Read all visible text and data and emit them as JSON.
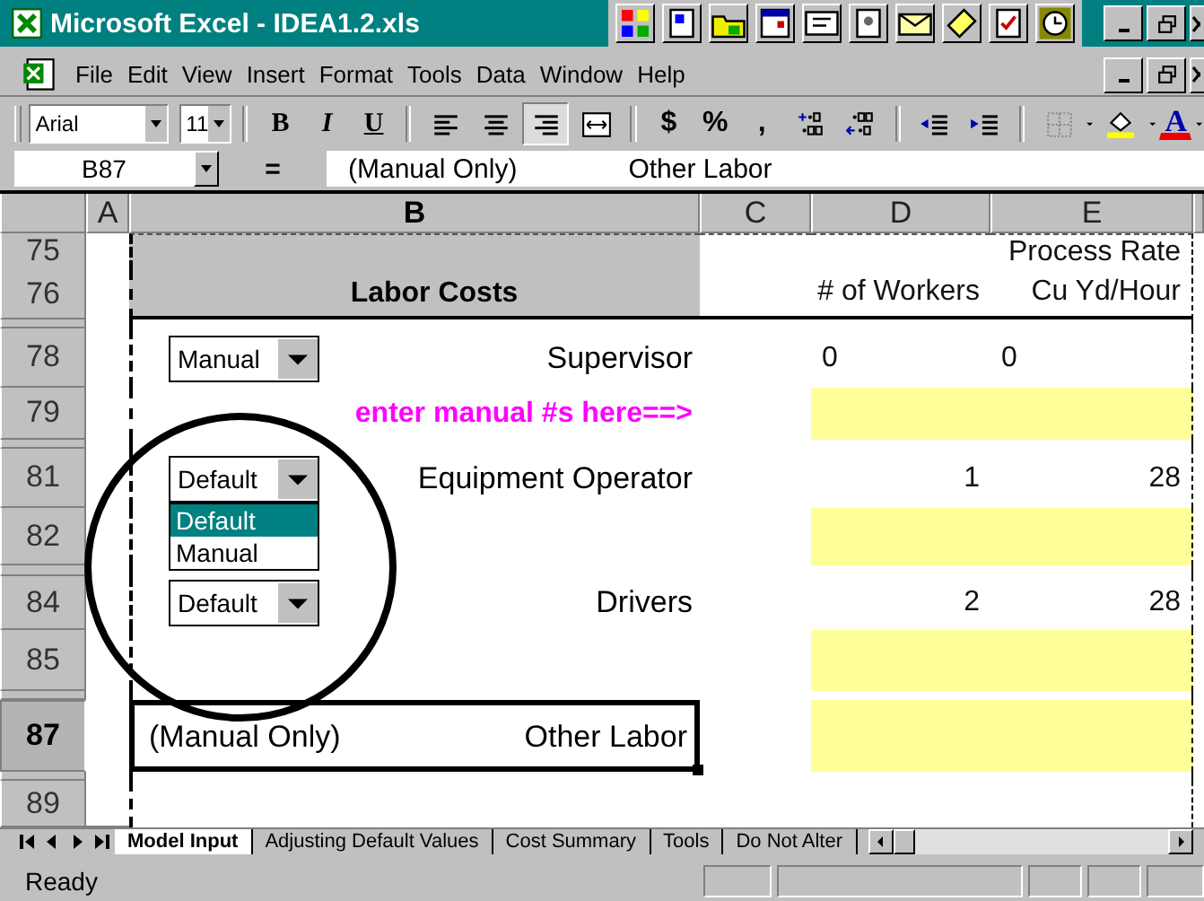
{
  "window": {
    "title": "Microsoft Excel - IDEA1.2.xls"
  },
  "menu": [
    "File",
    "Edit",
    "View",
    "Insert",
    "Format",
    "Tools",
    "Data",
    "Window",
    "Help"
  ],
  "toolbar": {
    "font": "Arial",
    "size": "11",
    "buttons": [
      {
        "kind": "separator"
      },
      {
        "kind": "bold",
        "text": "B",
        "pressed": false
      },
      {
        "kind": "italic",
        "text": "I",
        "pressed": false
      },
      {
        "kind": "underline",
        "text": "U",
        "pressed": false
      },
      {
        "kind": "separator"
      },
      {
        "kind": "align-left",
        "pressed": false
      },
      {
        "kind": "align-center",
        "pressed": false
      },
      {
        "kind": "align-right",
        "pressed": true
      },
      {
        "kind": "merge",
        "pressed": false
      },
      {
        "kind": "separator"
      },
      {
        "kind": "currency",
        "text": "$",
        "pressed": false
      },
      {
        "kind": "percent",
        "text": "%",
        "pressed": false
      },
      {
        "kind": "comma",
        "text": ",",
        "pressed": false
      },
      {
        "kind": "increase-decimal",
        "pressed": false
      },
      {
        "kind": "decrease-decimal",
        "pressed": false
      },
      {
        "kind": "separator"
      },
      {
        "kind": "outdent",
        "pressed": false
      },
      {
        "kind": "indent",
        "pressed": false
      },
      {
        "kind": "separator"
      },
      {
        "kind": "borders",
        "pressed": false
      },
      {
        "kind": "fill-color",
        "pressed": false
      },
      {
        "kind": "font-color",
        "text": "A",
        "pressed": false
      }
    ]
  },
  "formula_bar": {
    "cell": "B87",
    "equals": "=",
    "content": [
      "(Manual Only)",
      "Other Labor"
    ]
  },
  "columns": [
    {
      "label": "A",
      "active": false
    },
    {
      "label": "B",
      "active": true
    },
    {
      "label": "C",
      "active": false
    },
    {
      "label": "D",
      "active": false
    },
    {
      "label": "E",
      "active": false
    }
  ],
  "rows": [
    {
      "kind": "row",
      "number": "75",
      "active": false,
      "b": {
        "kind": "header"
      },
      "e": {
        "kind": "heading",
        "text": "Process Rate"
      }
    },
    {
      "kind": "row",
      "number": "76",
      "active": false,
      "b": {
        "kind": "header",
        "text": "Labor Costs"
      },
      "d": {
        "kind": "heading",
        "text": "# of Workers"
      },
      "e": {
        "kind": "heading",
        "text": "Cu Yd/Hour"
      }
    },
    {
      "kind": "collapsed"
    },
    {
      "kind": "row",
      "number": "78",
      "active": false,
      "b": {
        "kind": "label",
        "text": "Supervisor",
        "dropdown": {
          "value": "Manual",
          "expanded": false
        }
      },
      "d": {
        "kind": "text",
        "text": "0"
      },
      "e": {
        "kind": "text",
        "text": "0"
      }
    },
    {
      "kind": "row",
      "number": "79",
      "active": false,
      "b": {
        "kind": "hint",
        "text": "enter manual #s here==>"
      },
      "d": {
        "kind": "input"
      },
      "e": {
        "kind": "input"
      }
    },
    {
      "kind": "collapsed"
    },
    {
      "kind": "row",
      "number": "81",
      "active": false,
      "b": {
        "kind": "label",
        "text": "Equipment Operator",
        "dropdown": {
          "value": "Default",
          "expanded": true,
          "options": [
            {
              "label": "Default",
              "selected": true
            },
            {
              "label": "Manual",
              "selected": false
            }
          ]
        }
      },
      "d": {
        "kind": "number",
        "text": "1"
      },
      "e": {
        "kind": "number",
        "text": "28"
      }
    },
    {
      "kind": "row",
      "number": "82",
      "active": false,
      "d": {
        "kind": "input"
      },
      "e": {
        "kind": "input"
      }
    },
    {
      "kind": "collapsed"
    },
    {
      "kind": "row",
      "number": "84",
      "active": false,
      "b": {
        "kind": "label",
        "text": "Drivers",
        "dropdown": {
          "value": "Default",
          "expanded": false
        }
      },
      "d": {
        "kind": "number",
        "text": "2"
      },
      "e": {
        "kind": "number",
        "text": "28"
      }
    },
    {
      "kind": "row",
      "number": "85",
      "active": false,
      "d": {
        "kind": "input"
      },
      "e": {
        "kind": "input"
      }
    },
    {
      "kind": "collapsed"
    },
    {
      "kind": "row",
      "number": "87",
      "active": true,
      "b": {
        "kind": "label",
        "note": "(Manual Only)",
        "text": "Other Labor"
      },
      "d": {
        "kind": "input"
      },
      "e": {
        "kind": "input"
      }
    },
    {
      "kind": "collapsed"
    },
    {
      "kind": "row",
      "number": "89",
      "active": false
    }
  ],
  "sheet_tabs": [
    {
      "label": "Model Input",
      "selected": true
    },
    {
      "label": "Adjusting Default Values",
      "selected": false
    },
    {
      "label": "Cost Summary",
      "selected": false
    },
    {
      "label": "Tools",
      "selected": false
    },
    {
      "label": "Do Not Alter",
      "selected": false
    }
  ],
  "status_bar": {
    "text": "Ready"
  }
}
